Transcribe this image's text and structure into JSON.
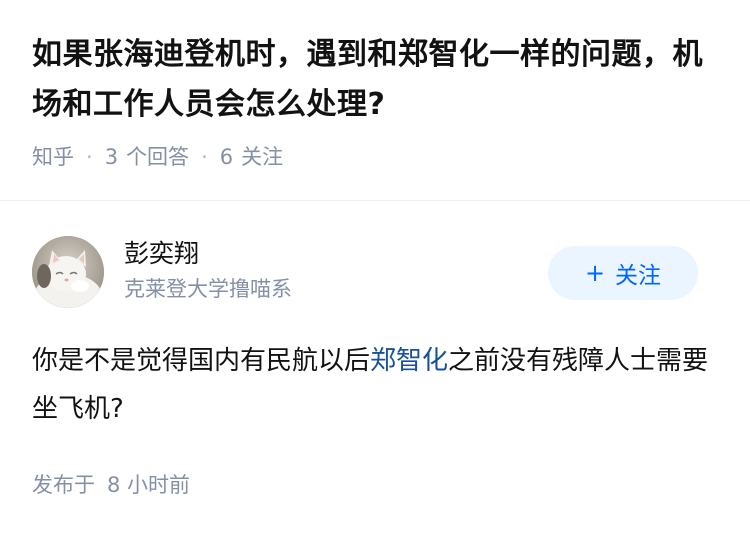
{
  "question": {
    "title": "如果张海迪登机时，遇到和郑智化一样的问题，机场和工作人员会怎么处理?",
    "source": "知乎",
    "separator": "·",
    "answer_count": "3",
    "answer_label": "个回答",
    "follow_count": "6",
    "follow_label": "关注"
  },
  "author": {
    "name": "彭奕翔",
    "bio": "克莱登大学撸喵系",
    "avatar_icon": "cat-avatar-icon"
  },
  "follow_button": {
    "icon": "plus-icon",
    "plus": "+",
    "label": "关注",
    "text_color": "#0066ff",
    "background": "#ebf5ff"
  },
  "answer": {
    "text_before": "你是不是觉得国内有民航以后",
    "link_text": "郑智化",
    "text_after": "之前没有残障人士需要坐飞机?",
    "link_color": "#175199"
  },
  "post_time": {
    "prefix": "发布于",
    "value": "8 小时前"
  }
}
